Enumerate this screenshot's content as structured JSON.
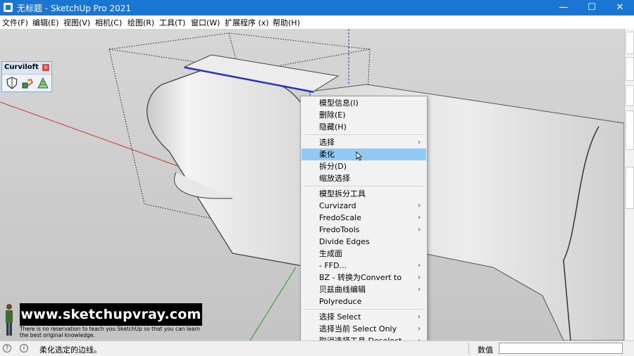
{
  "window": {
    "title": "无标题 - SketchUp Pro 2021",
    "minimize_glyph": "—",
    "maximize_glyph": "☐",
    "close_glyph": "✕"
  },
  "menubar": {
    "items": [
      "文件(F)",
      "编辑(E)",
      "视图(V)",
      "相机(C)",
      "绘图(R)",
      "工具(T)",
      "窗口(W)",
      "扩展程序 (x)",
      "帮助(H)"
    ]
  },
  "curviloft": {
    "title": "Curviloft",
    "close_glyph": "×",
    "tools": [
      "curviloft-shield-icon",
      "curviloft-skin-icon",
      "curviloft-loft-icon"
    ]
  },
  "context_menu": {
    "highlighted_index": 4,
    "items": [
      {
        "label": "模型信息(I)",
        "submenu": false
      },
      {
        "label": "删除(E)",
        "submenu": false
      },
      {
        "label": "隐藏(H)",
        "submenu": false
      },
      {
        "label": "选择",
        "submenu": true
      },
      {
        "label": "柔化",
        "submenu": false
      },
      {
        "label": "拆分(D)",
        "submenu": false
      },
      {
        "label": "缩放选择",
        "submenu": false
      },
      {
        "label": "模型拆分工具",
        "submenu": false
      },
      {
        "label": "Curvizard",
        "submenu": true
      },
      {
        "label": "FredoScale",
        "submenu": true
      },
      {
        "label": "FredoTools",
        "submenu": true
      },
      {
        "label": "Divide Edges",
        "submenu": false
      },
      {
        "label": "生成面",
        "submenu": false
      },
      {
        "label": "- FFD...",
        "submenu": true
      },
      {
        "label": "BZ - 转换为Convert to",
        "submenu": true
      },
      {
        "label": "贝兹曲线编辑",
        "submenu": true
      },
      {
        "label": "Polyreduce",
        "submenu": false
      },
      {
        "label": "选择 Select",
        "submenu": true
      },
      {
        "label": "选择当前 Select Only",
        "submenu": true
      },
      {
        "label": "取消选择工具 Deselect",
        "submenu": true
      }
    ],
    "submenu_glyph": "›"
  },
  "watermark": {
    "banner": "www.sketchupvray.com",
    "line1": "There is no reservation to teach you SketchUp so that you can learn",
    "line2": "the best original knowledge."
  },
  "statusbar": {
    "message": "柔化选定的边线。",
    "value_label": "数值",
    "value": "",
    "icon_a": "?",
    "icon_b": "i"
  },
  "colors": {
    "titlebar": "#1976d2",
    "highlight": "#91c9f7",
    "selection_edge": "#1f2fd6"
  }
}
